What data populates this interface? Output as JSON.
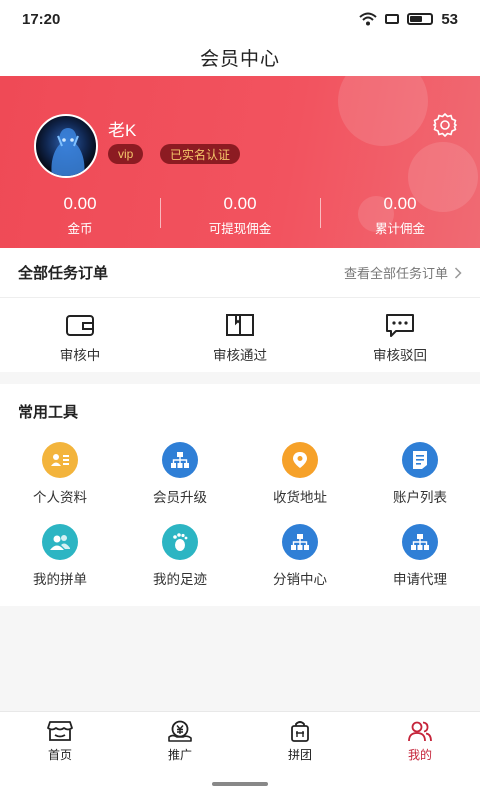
{
  "status_bar": {
    "time": "17:20",
    "battery": "53"
  },
  "nav": {
    "title": "会员中心"
  },
  "profile": {
    "username": "老K",
    "badge_vip": "vip",
    "badge_verified": "已实名认证",
    "stats": [
      {
        "value": "0.00",
        "label": "金币"
      },
      {
        "value": "0.00",
        "label": "可提现佣金"
      },
      {
        "value": "0.00",
        "label": "累计佣金"
      }
    ]
  },
  "orders": {
    "title": "全部任务订单",
    "view_all": "查看全部任务订单",
    "items": [
      {
        "label": "审核中",
        "icon": "wallet-icon"
      },
      {
        "label": "审核通过",
        "icon": "book-icon"
      },
      {
        "label": "审核驳回",
        "icon": "chat-dots-icon"
      }
    ]
  },
  "tools": {
    "title": "常用工具",
    "items": [
      {
        "label": "个人资料",
        "icon": "profile-card-icon",
        "color": "#f3b43c"
      },
      {
        "label": "会员升级",
        "icon": "hierarchy-icon",
        "color": "#2f7fd6"
      },
      {
        "label": "收货地址",
        "icon": "location-pin-icon",
        "color": "#f6a129"
      },
      {
        "label": "账户列表",
        "icon": "document-list-icon",
        "color": "#2f7fd6"
      },
      {
        "label": "我的拼单",
        "icon": "group-users-icon",
        "color": "#2cb5c3"
      },
      {
        "label": "我的足迹",
        "icon": "footprint-icon",
        "color": "#2cb5c3"
      },
      {
        "label": "分销中心",
        "icon": "hierarchy-icon",
        "color": "#2f7fd6"
      },
      {
        "label": "申请代理",
        "icon": "hierarchy-icon",
        "color": "#2f7fd6"
      }
    ]
  },
  "tabs": [
    {
      "label": "首页",
      "icon": "store-icon",
      "active": false
    },
    {
      "label": "推广",
      "icon": "yuan-coin-icon",
      "active": false
    },
    {
      "label": "拼团",
      "icon": "shopping-bag-icon",
      "active": false
    },
    {
      "label": "我的",
      "icon": "users-icon",
      "active": true
    }
  ],
  "colors": {
    "brand_red": "#ef4a56",
    "badge_bg": "#8c1b22",
    "badge_text": "#f5c66a",
    "active_tab": "#c5243a"
  }
}
